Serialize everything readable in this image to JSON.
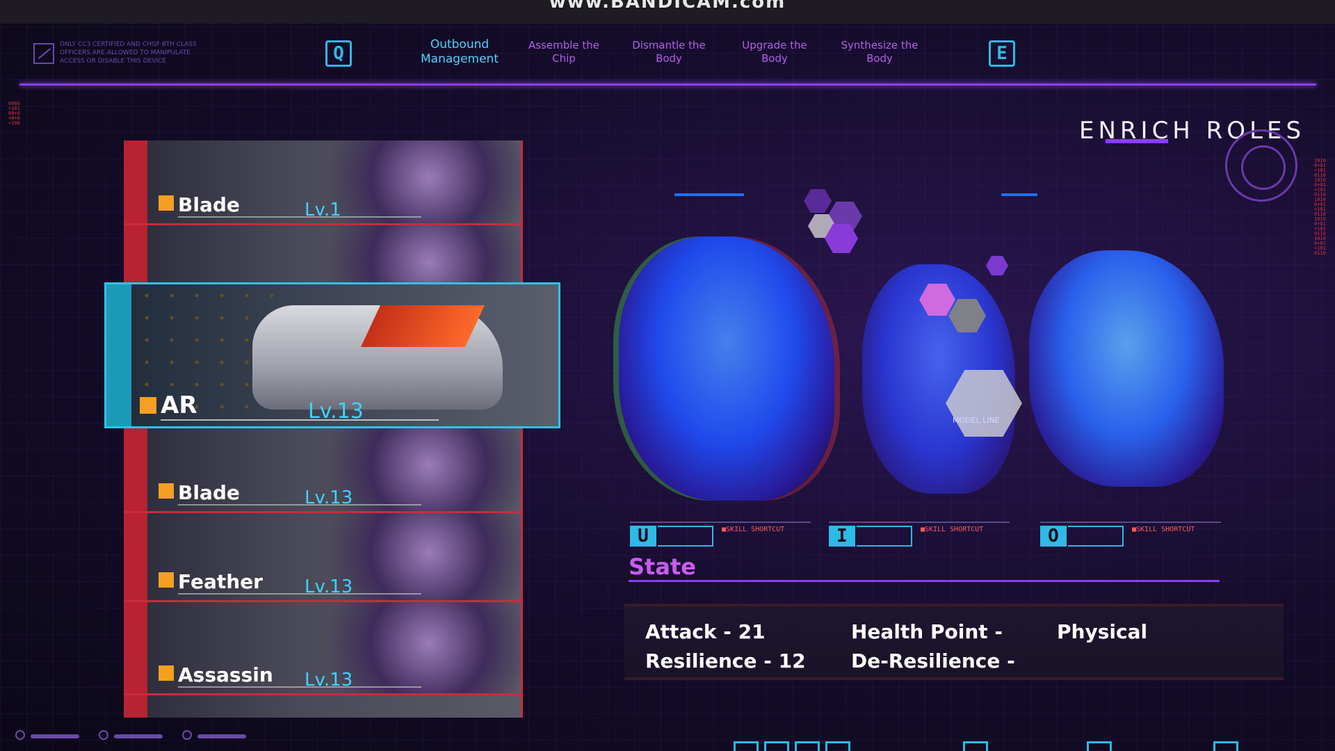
{
  "watermark": "www.BANDICAM.com",
  "top_nav": {
    "warning_text": "ONLY CC3 CERTIFIED AND CHGF 8TH CLASS OFFICERS ARE ALLOWED TO MANIPULATE ACCESS OR DISABLE THIS DEVICE",
    "prev_key": "Q",
    "next_key": "E",
    "tabs": [
      {
        "label": "Outbound Management",
        "active": true
      },
      {
        "label": "Assemble the Chip",
        "active": false
      },
      {
        "label": "Dismantle the Body",
        "active": false
      },
      {
        "label": "Upgrade the Body",
        "active": false
      },
      {
        "label": "Synthesize the Body",
        "active": false
      }
    ]
  },
  "header": {
    "title": "ENRICH ROLES"
  },
  "roster": [
    {
      "name": "Blade",
      "level": "Lv.1"
    },
    {
      "name": "",
      "level": ""
    },
    {
      "name": "AR",
      "level": "Lv.13",
      "selected": true
    },
    {
      "name": "Blade",
      "level": "Lv.13"
    },
    {
      "name": "Feather",
      "level": "Lv.13"
    },
    {
      "name": "Assassin",
      "level": "Lv.13"
    }
  ],
  "preview": {
    "model_label": "MODEL LINE"
  },
  "skills": [
    {
      "key": "U",
      "label": "■SKILL SHORTCUT"
    },
    {
      "key": "I",
      "label": "■SKILL SHORTCUT"
    },
    {
      "key": "O",
      "label": "■SKILL SHORTCUT"
    }
  ],
  "state": {
    "title": "State",
    "attack": "Attack - 21",
    "resilience": "Resilience - 12",
    "health_point": "Health Point -",
    "de_resilience": "De-Resilience -",
    "damage_type": "Physical"
  },
  "colors": {
    "accent_cyan": "#2fb9e6",
    "accent_purple": "#8a3ff0",
    "card_red": "#c82c3c",
    "level_color": "#3fd3ff"
  }
}
